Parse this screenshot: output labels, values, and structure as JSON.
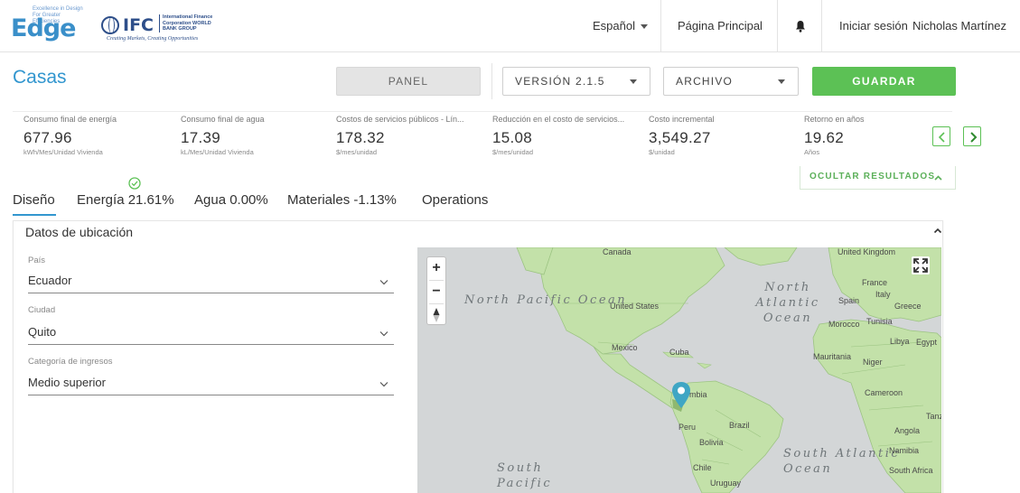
{
  "header": {
    "logo_text": "Edge",
    "logo_tagline": "Excellence in Design For Greater Efficiencies",
    "ifc_text": "IFC",
    "ifc_sub": "International Finance Corporation WORLD BANK GROUP",
    "ifc_motto": "Creating Markets, Creating Opportunities",
    "language": "Español",
    "home": "Página Principal",
    "login": "Iniciar sesión",
    "user": "Nicholas Martínez"
  },
  "toolbar": {
    "title": "Casas",
    "panel_label": "PANEL",
    "version_label": "VERSIÓN 2.1.5",
    "file_label": "ARCHIVO",
    "save_label": "GUARDAR"
  },
  "metrics": [
    {
      "label": "Consumo final de energía",
      "value": "677.96",
      "unit": "kWh/Mes/Unidad Vivienda"
    },
    {
      "label": "Consumo final de agua",
      "value": "17.39",
      "unit": "kL/Mes/Unidad Vivienda"
    },
    {
      "label": "Costos de servicios públicos - Lín...",
      "value": "178.32",
      "unit": "$/mes/unidad"
    },
    {
      "label": "Reducción en el costo de servicios...",
      "value": "15.08",
      "unit": "$/mes/unidad"
    },
    {
      "label": "Costo incremental",
      "value": "3,549.27",
      "unit": "$/unidad"
    },
    {
      "label": "Retorno en años",
      "value": "19.62",
      "unit": "Años"
    }
  ],
  "hide_results_label": "OCULTAR RESULTADOS",
  "tabs": [
    {
      "label": "Diseño"
    },
    {
      "label": "Energía 21.61%"
    },
    {
      "label": "Agua 0.00%"
    },
    {
      "label": "Materiales -1.13%"
    },
    {
      "label": "Operations"
    }
  ],
  "location": {
    "title": "Datos de ubicación",
    "country_label": "País",
    "country_value": "Ecuador",
    "city_label": "Ciudad",
    "city_value": "Quito",
    "income_label": "Categoría de ingresos",
    "income_value": "Medio superior"
  },
  "map": {
    "labels": {
      "canada": "Canada",
      "united_states": "United States",
      "mexico": "Mexico",
      "cuba": "Cuba",
      "colombia": "ombia",
      "peru": "Peru",
      "brazil": "Brazil",
      "bolivia": "Bolivia",
      "chile": "Chile",
      "uruguay": "Uruguay",
      "united_kingdom": "United Kingdom",
      "france": "France",
      "spain": "Spain",
      "italy": "Italy",
      "greece": "Greece",
      "morocco": "Morocco",
      "tunisia": "Tunisia",
      "libya": "Libya",
      "egypt": "Egypt",
      "mauritania": "Mauritania",
      "niger": "Niger",
      "cameroon": "Cameroon",
      "angola": "Angola",
      "namibia": "Namibia",
      "south_africa": "South Africa",
      "tanza": "Tanza",
      "north_pacific": "North Pacific Ocean",
      "north_atlantic": "North Atlantic Ocean",
      "south_atlantic": "South Atlantic Ocean",
      "south_pacific": "South Pacific"
    },
    "zoom_in": "+",
    "zoom_out": "−",
    "marker_location": "Quito"
  },
  "colors": {
    "accent_blue": "#3296cf",
    "accent_green": "#5cc155",
    "land": "#c3e1a9",
    "water": "#d3d6d7",
    "pin": "#3fa6c4"
  }
}
